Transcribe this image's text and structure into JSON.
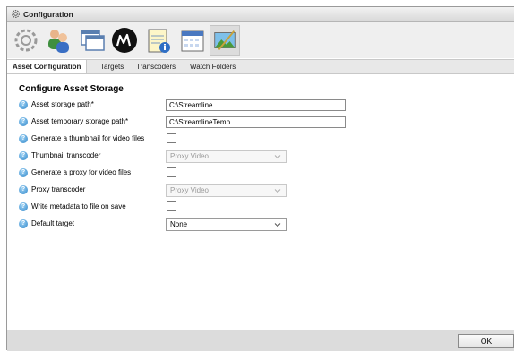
{
  "window": {
    "title": "Configuration"
  },
  "toolbar": {
    "icons": [
      "gear-icon",
      "users-icon",
      "windows-icon",
      "m-logo-icon",
      "notepad-info-icon",
      "calendar-icon",
      "landscape-image-icon"
    ],
    "selected": "landscape-image-icon"
  },
  "tabs": [
    {
      "label": "Asset Configuration",
      "active": true
    },
    {
      "label": "Targets",
      "active": false
    },
    {
      "label": "Transcoders",
      "active": false
    },
    {
      "label": "Watch Folders",
      "active": false
    }
  ],
  "section": {
    "heading": "Configure Asset Storage"
  },
  "fields": {
    "storage_path": {
      "label": "Asset storage path*",
      "value": "C:\\Streamline"
    },
    "temp_path": {
      "label": "Asset temporary storage path*",
      "value": "C:\\StreamlineTemp"
    },
    "gen_thumbnail": {
      "label": "Generate a thumbnail for video files",
      "checked": false
    },
    "thumb_transcoder": {
      "label": "Thumbnail transcoder",
      "value": "Proxy Video",
      "disabled": true
    },
    "gen_proxy": {
      "label": "Generate a proxy for video files",
      "checked": false
    },
    "proxy_transcoder": {
      "label": "Proxy transcoder",
      "value": "Proxy Video",
      "disabled": true
    },
    "write_metadata": {
      "label": "Write metadata to file on save",
      "checked": false
    },
    "default_target": {
      "label": "Default target",
      "value": "None",
      "disabled": false
    }
  },
  "footer": {
    "ok_label": "OK"
  },
  "colors": {
    "help_icon": "#2f86c9",
    "footer_bg": "#dcdcdc"
  }
}
